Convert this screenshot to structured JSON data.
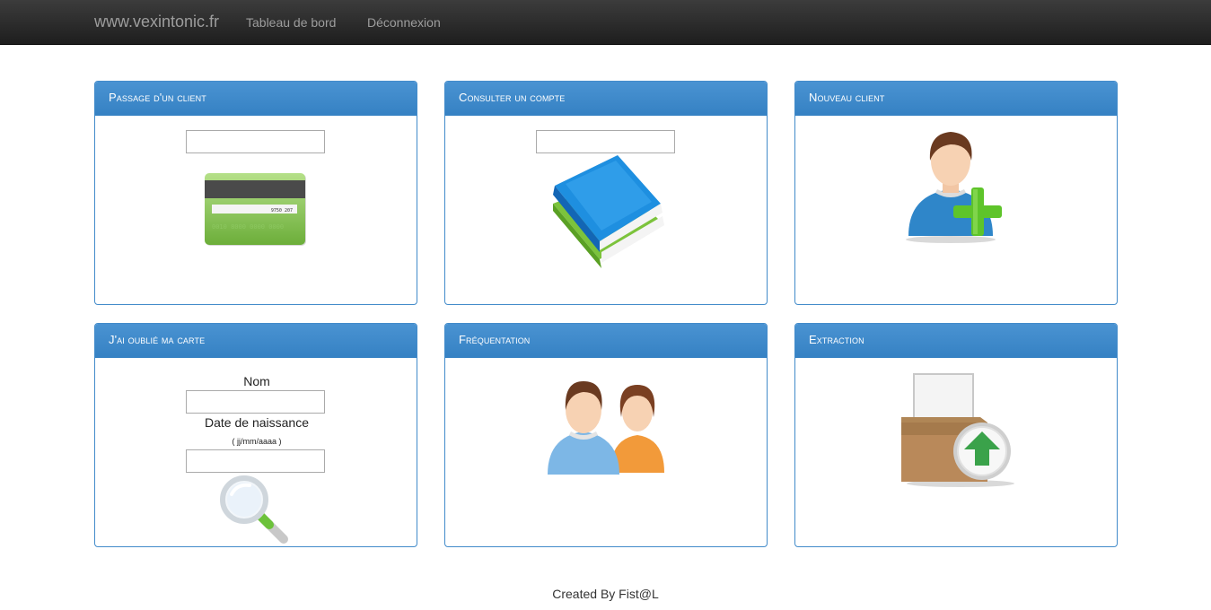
{
  "navbar": {
    "brand": "www.vexintonic.fr",
    "links": [
      "Tableau de bord",
      "Déconnexion"
    ]
  },
  "panels": {
    "passage": {
      "title": "Passage d'un client",
      "card_number_top": "9750 207",
      "card_number_bottom": "0010 8000 0000 0000"
    },
    "consulter": {
      "title": "Consulter un compte"
    },
    "nouveau": {
      "title": "Nouveau client"
    },
    "oublie": {
      "title": "J'ai oublié ma carte",
      "nom_label": "Nom",
      "date_label": "Date de naissance",
      "date_hint": "( jj/mm/aaaa )"
    },
    "frequentation": {
      "title": "Fréquentation"
    },
    "extraction": {
      "title": "Extraction"
    }
  },
  "footer": {
    "text": "Created By Fist@L"
  },
  "colors": {
    "navbar": "#222222",
    "panel_border": "#428bca",
    "panel_heading": "#3a87c8"
  },
  "icons": [
    "credit-card-icon",
    "books-icon",
    "add-user-icon",
    "magnifier-icon",
    "users-icon",
    "box-export-icon"
  ]
}
